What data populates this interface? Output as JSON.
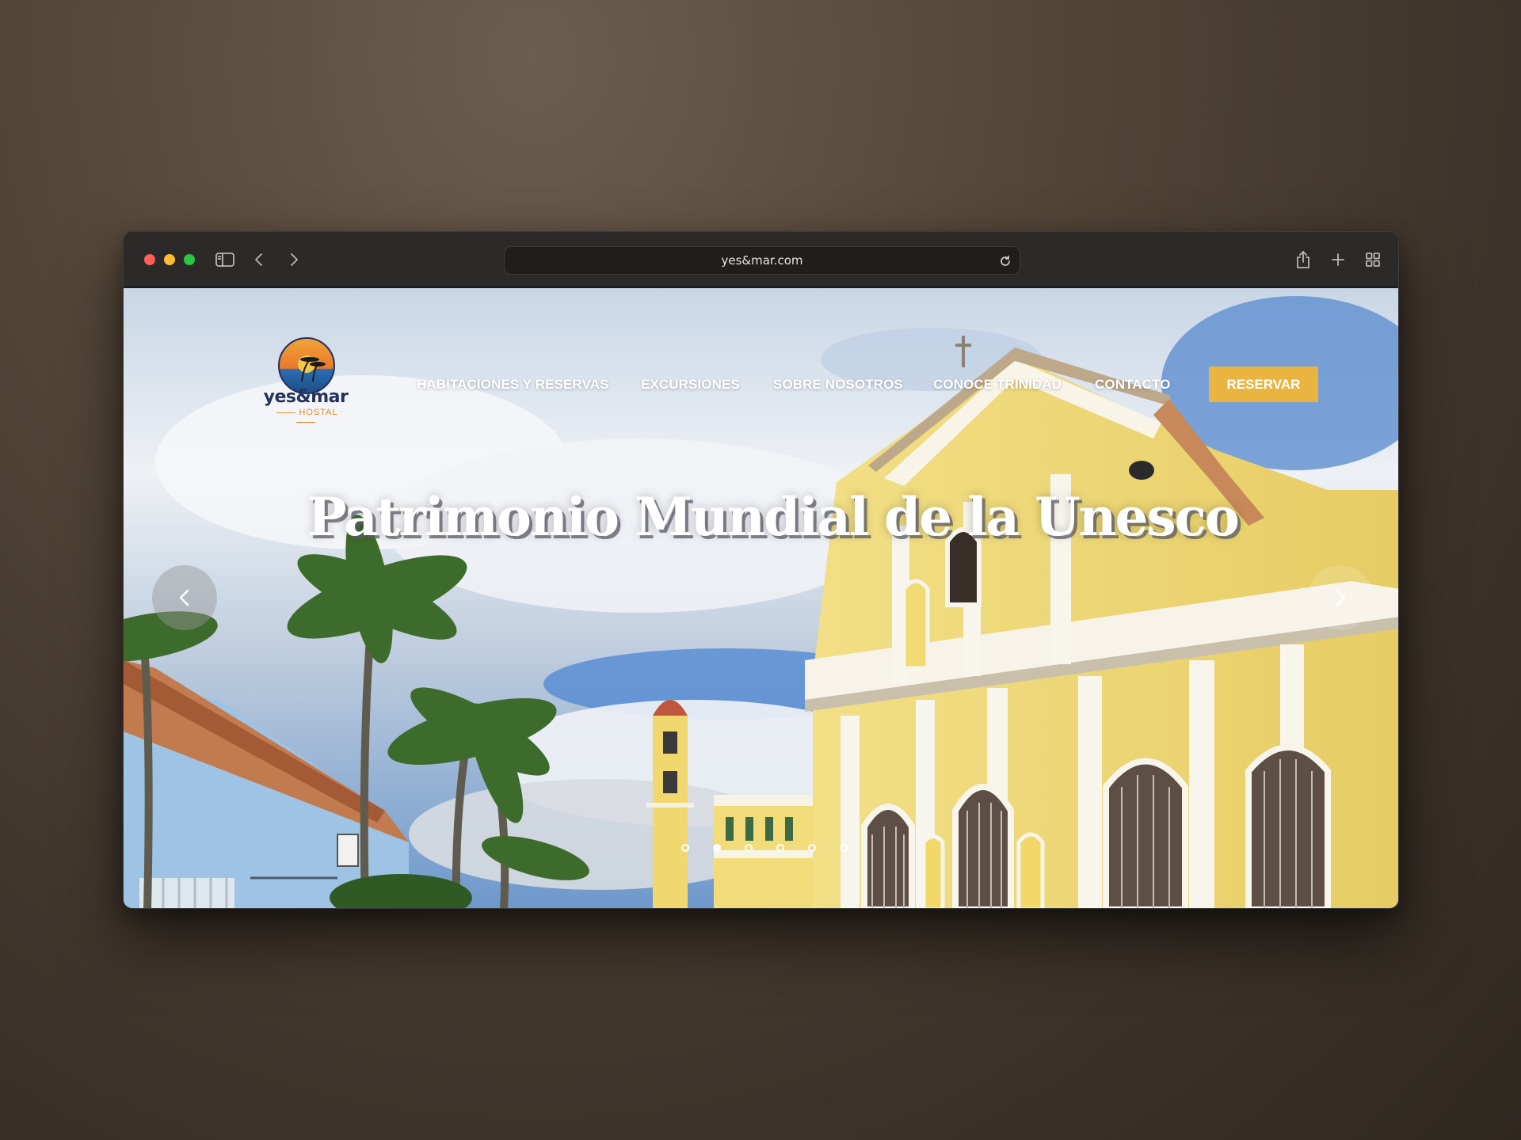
{
  "browser": {
    "url": "yes&mar.com"
  },
  "site": {
    "logo_name": "yes&mar",
    "logo_sub": "HOSTAL"
  },
  "nav": {
    "items": [
      {
        "label": "HABITACIONES Y RESERVAS"
      },
      {
        "label": "EXCURSIONES"
      },
      {
        "label": "SOBRE NOSOTROS"
      },
      {
        "label": "CONOCE TRINIDAD"
      },
      {
        "label": "CONTACTO"
      }
    ],
    "cta_label": "RESERVAR"
  },
  "hero": {
    "headline": "Patrimonio Mundial de la Unesco",
    "slides_count": 6,
    "active_slide": 2
  },
  "colors": {
    "accent": "#e9b43f",
    "logo_navy": "#22325a",
    "logo_orange": "#e08a2a"
  },
  "icons": [
    "sidebar-icon",
    "chevron-left-icon",
    "chevron-right-icon",
    "reload-icon",
    "share-icon",
    "plus-icon",
    "tabs-grid-icon"
  ]
}
